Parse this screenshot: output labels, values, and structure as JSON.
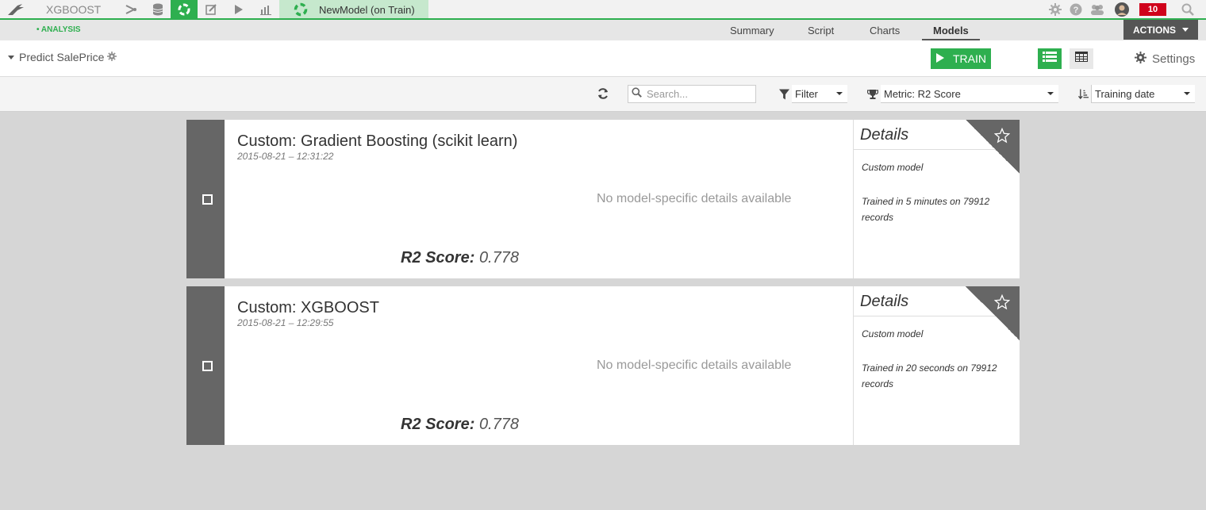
{
  "nav": {
    "project": "XGBOOST",
    "current_tab": "NewModel (on Train)",
    "notifications": "10"
  },
  "subbar": {
    "section": "• ANALYSIS",
    "tabs": [
      "Summary",
      "Script",
      "Charts",
      "Models"
    ],
    "active_tab": "Models",
    "actions_label": "ACTIONS"
  },
  "header": {
    "title": "Predict SalePrice",
    "train_label": "TRAIN",
    "settings_label": "Settings"
  },
  "toolbar": {
    "search_placeholder": "Search...",
    "filter_label": "Filter",
    "metric_label": "Metric: R2 Score",
    "sort_label": "Training date"
  },
  "models": [
    {
      "name": "Custom: Gradient Boosting (scikit learn)",
      "date": "2015-08-21 – 12:31:22",
      "no_details": "No model-specific details available",
      "score_label": "R2 Score:",
      "score_value": "0.778",
      "details_title": "Details",
      "details_type": "Custom model",
      "details_training": "Trained in 5 minutes on 79912 records"
    },
    {
      "name": "Custom: XGBOOST",
      "date": "2015-08-21 – 12:29:55",
      "no_details": "No model-specific details available",
      "score_label": "R2 Score:",
      "score_value": "0.778",
      "details_title": "Details",
      "details_type": "Custom model",
      "details_training": "Trained in 20 seconds on 79912 records"
    }
  ],
  "colors": {
    "accent": "#2eaf4f",
    "sidebar": "#666666",
    "alert": "#d0021b"
  }
}
